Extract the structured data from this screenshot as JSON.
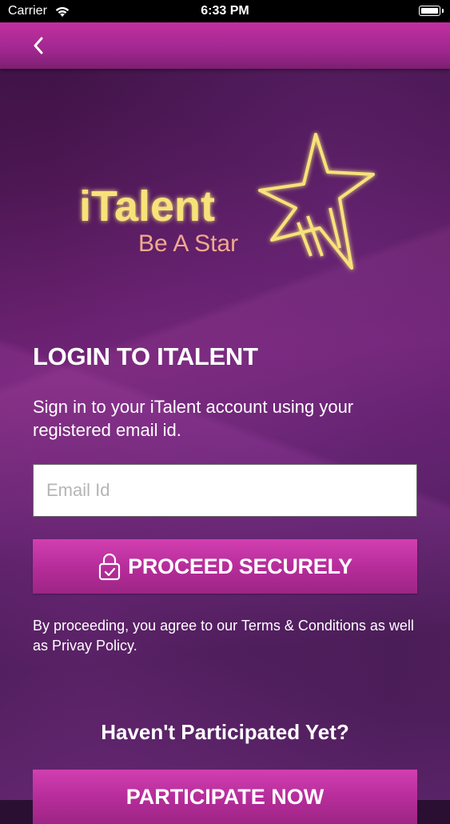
{
  "status_bar": {
    "carrier": "Carrier",
    "time": "6:33 PM"
  },
  "nav": {
    "back_icon": "chevron-left-icon"
  },
  "logo": {
    "wordmark": "iTalent",
    "tagline": "Be A Star",
    "icon": "star-icon",
    "colors": {
      "gold": "#f7e27a",
      "glow": "#f2c94c",
      "tagline": "#f0a98c"
    }
  },
  "login": {
    "title": "LOGIN TO ITALENT",
    "subtitle": "Sign in to your iTalent account using your registered email id.",
    "email_placeholder": "Email Id",
    "email_value": "",
    "proceed_label": "PROCEED SECURELY",
    "proceed_icon": "lock-check-icon",
    "terms_text": "By proceeding, you agree to our Terms & Conditions as well as Privay Policy."
  },
  "signup": {
    "prompt": "Haven't Participated Yet?",
    "participate_label": "PARTICIPATE NOW"
  },
  "colors": {
    "accent": "#b72d9b",
    "nav": "#a02790",
    "background": "#4a1650"
  }
}
